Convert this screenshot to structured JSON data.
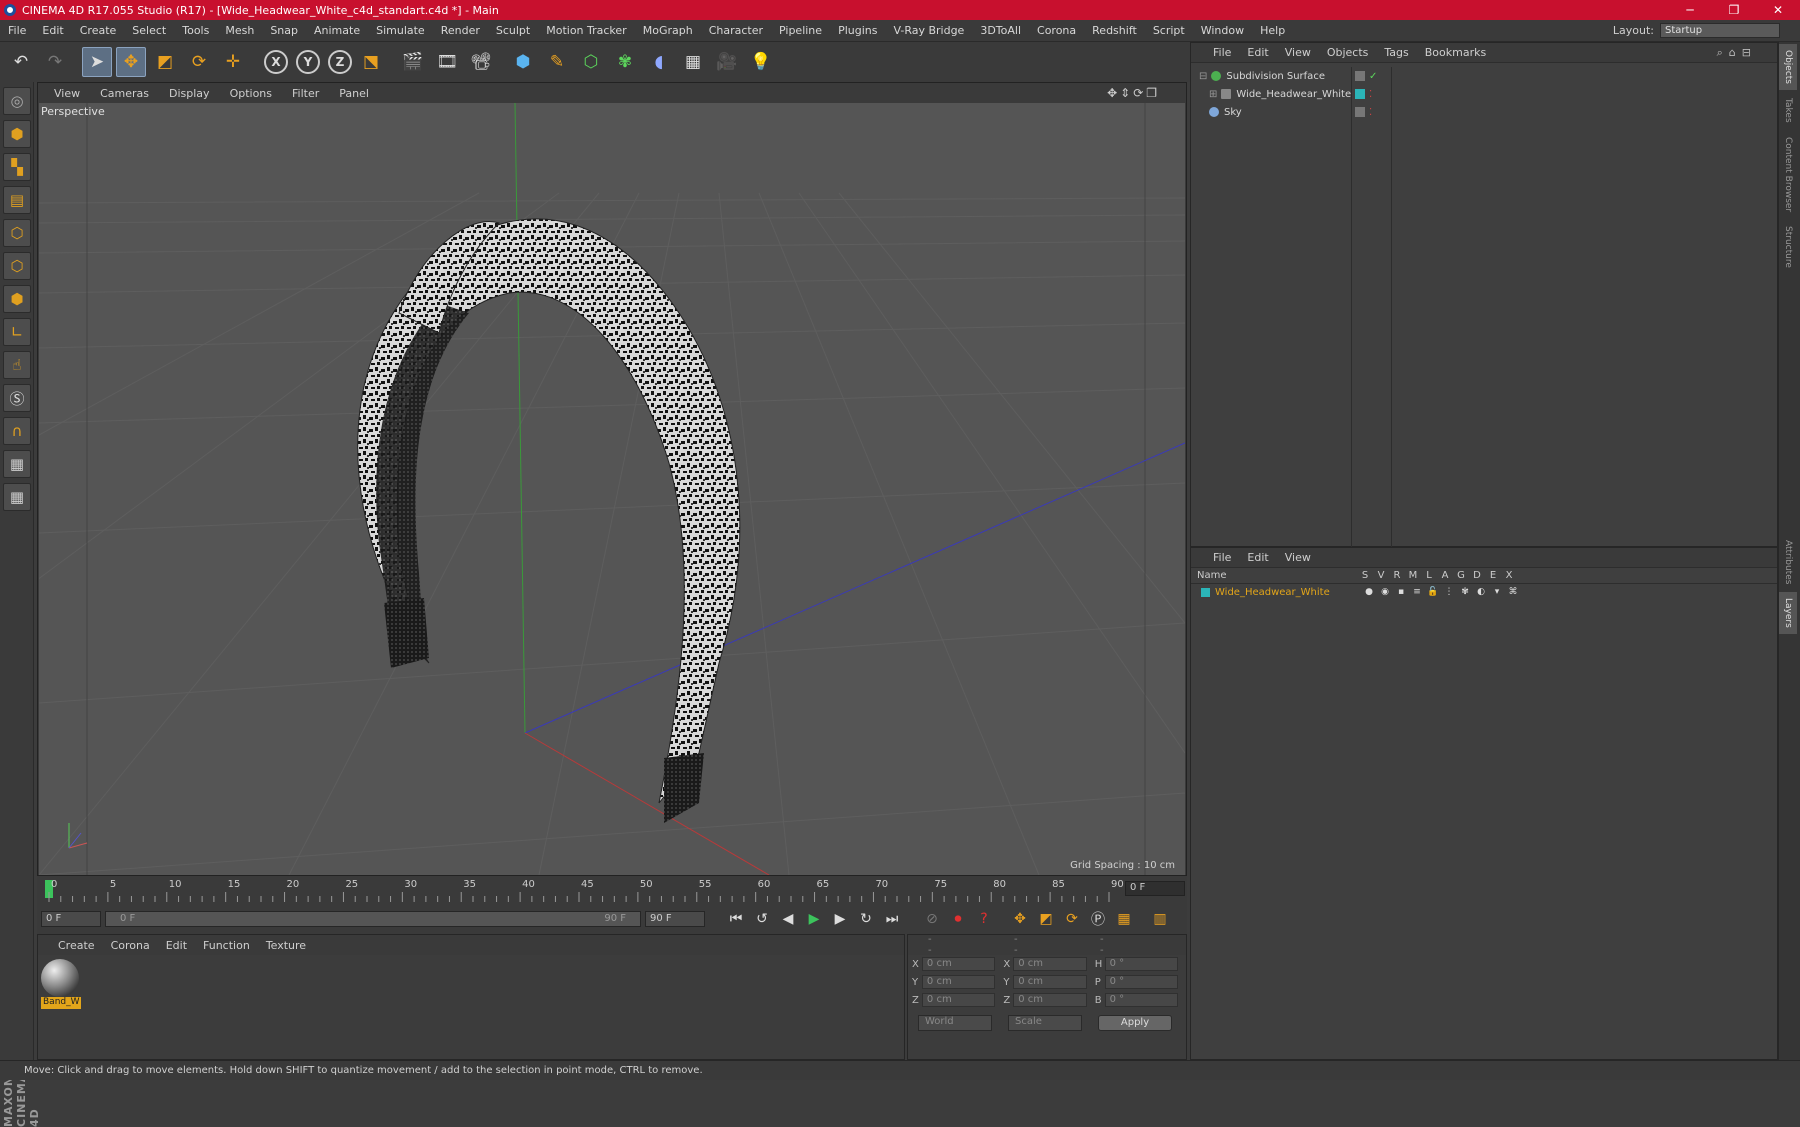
{
  "title_bar": {
    "title": "CINEMA 4D R17.055 Studio (R17) - [Wide_Headwear_White_c4d_standart.c4d *] - Main",
    "min": "─",
    "max": "❐",
    "close": "✕"
  },
  "menu": [
    "File",
    "Edit",
    "Create",
    "Select",
    "Tools",
    "Mesh",
    "Snap",
    "Animate",
    "Simulate",
    "Render",
    "Sculpt",
    "Motion Tracker",
    "MoGraph",
    "Character",
    "Pipeline",
    "Plugins",
    "V-Ray Bridge",
    "3DToAll",
    "Corona",
    "Redshift",
    "Script",
    "Window",
    "Help"
  ],
  "layout": {
    "label": "Layout:",
    "value": "Startup"
  },
  "viewport": {
    "menu": [
      "View",
      "Cameras",
      "Display",
      "Options",
      "Filter",
      "Panel"
    ],
    "label": "Perspective",
    "grid_spacing": "Grid Spacing : 10 cm"
  },
  "timeline": {
    "ticks": [
      "0",
      "5",
      "10",
      "15",
      "20",
      "25",
      "30",
      "35",
      "40",
      "45",
      "50",
      "55",
      "60",
      "65",
      "70",
      "75",
      "80",
      "85",
      "90"
    ],
    "current_frame": "0 F"
  },
  "transport": {
    "start": "0 F",
    "range_start": "0 F",
    "range_end": "90 F",
    "end": "90 F"
  },
  "material_manager": {
    "menu": [
      "Create",
      "Corona",
      "Edit",
      "Function",
      "Texture"
    ],
    "material_name": "Band_W"
  },
  "coordinates": {
    "heads": [
      "--",
      "--",
      "--"
    ],
    "rows": [
      {
        "a1": "X",
        "v1": "0 cm",
        "a2": "X",
        "v2": "0 cm",
        "a3": "H",
        "v3": "0 °"
      },
      {
        "a1": "Y",
        "v1": "0 cm",
        "a2": "Y",
        "v2": "0 cm",
        "a3": "P",
        "v3": "0 °"
      },
      {
        "a1": "Z",
        "v1": "0 cm",
        "a2": "Z",
        "v2": "0 cm",
        "a3": "B",
        "v3": "0 °"
      }
    ],
    "world": "World",
    "scale": "Scale",
    "apply": "Apply"
  },
  "object_manager": {
    "menu": [
      "File",
      "Edit",
      "View",
      "Objects",
      "Tags",
      "Bookmarks"
    ],
    "objects": [
      {
        "name": "Subdivision Surface",
        "color": "#4caf50"
      },
      {
        "name": "Wide_Headwear_White",
        "color": "#2bb5b8"
      },
      {
        "name": "Sky",
        "color": "#7fa7d9"
      }
    ]
  },
  "layer_manager": {
    "menu": [
      "File",
      "Edit",
      "View"
    ],
    "columns": [
      "Name",
      "S",
      "V",
      "R",
      "M",
      "L",
      "A",
      "G",
      "D",
      "E",
      "X"
    ],
    "layer_name": "Wide_Headwear_White"
  },
  "right_tabs": [
    "Objects",
    "Takes",
    "Content Browser",
    "Structure",
    "Attributes",
    "Layers"
  ],
  "status": "Move: Click and drag to move elements. Hold down SHIFT to quantize movement / add to the selection in point mode, CTRL to remove.",
  "branding": "MAXON CINEMA 4D"
}
